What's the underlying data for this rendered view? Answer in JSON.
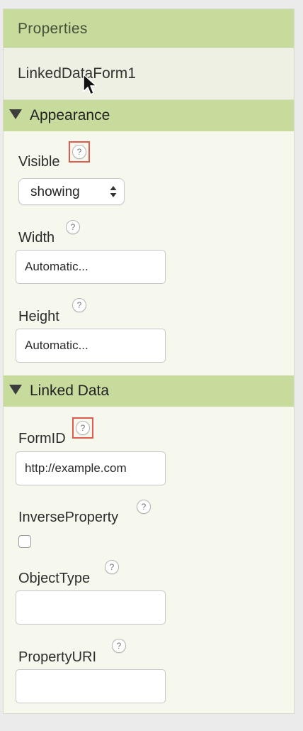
{
  "panel": {
    "title": "Properties",
    "component_name": "LinkedDataForm1"
  },
  "help_glyph": "?",
  "appearance": {
    "header": "Appearance",
    "visible_label": "Visible",
    "visible_value": "showing",
    "width_label": "Width",
    "width_value": "Automatic...",
    "height_label": "Height",
    "height_value": "Automatic..."
  },
  "linked_data": {
    "header": "Linked Data",
    "formid_label": "FormID",
    "formid_value": "http://example.com",
    "inverse_label": "InverseProperty",
    "inverse_checked": false,
    "objecttype_label": "ObjectType",
    "objecttype_value": "",
    "propertyuri_label": "PropertyURI",
    "propertyuri_value": ""
  },
  "colors": {
    "header_green": "#c7db9c",
    "panel_bg": "#f6f8ee",
    "highlight_red": "#e05a4e"
  }
}
